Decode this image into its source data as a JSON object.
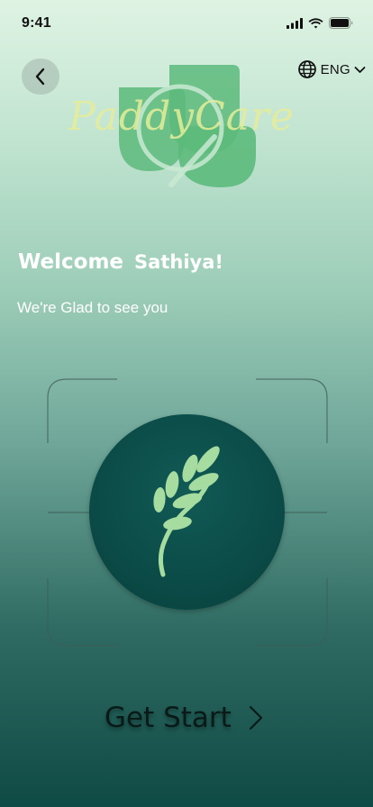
{
  "status": {
    "time": "9:41"
  },
  "header": {
    "language": "ENG"
  },
  "logo": {
    "text": "PaddyCare"
  },
  "welcome": {
    "greeting": "Welcome",
    "name": "Sathiya!",
    "subtitle": "We're Glad to see you"
  },
  "cta": {
    "label": "Get Start"
  },
  "colors": {
    "accent": "#0b4b47",
    "leaf": "#a6dca0",
    "logo_leaf": "#5cba7b"
  }
}
